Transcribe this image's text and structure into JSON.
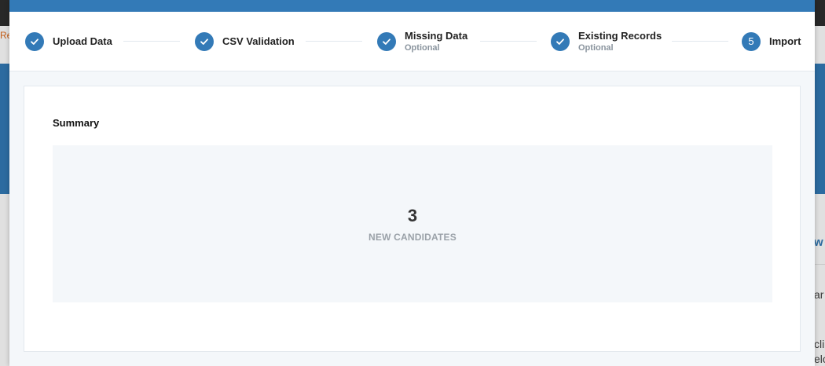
{
  "background": {
    "left_fragment": "Re",
    "right_fragments": [
      "w",
      "ar",
      "cli",
      "elo"
    ]
  },
  "stepper": {
    "steps": [
      {
        "label": "Upload Data",
        "sub": "",
        "state": "done"
      },
      {
        "label": "CSV Validation",
        "sub": "",
        "state": "done"
      },
      {
        "label": "Missing Data",
        "sub": "Optional",
        "state": "done"
      },
      {
        "label": "Existing Records",
        "sub": "Optional",
        "state": "done"
      },
      {
        "label": "Import",
        "sub": "",
        "state": "current",
        "number": "5"
      }
    ]
  },
  "summary": {
    "title": "Summary",
    "count": "3",
    "count_label": "NEW CANDIDATES"
  },
  "colors": {
    "accent": "#337ab7",
    "panel_bg": "#f4f7fa"
  }
}
